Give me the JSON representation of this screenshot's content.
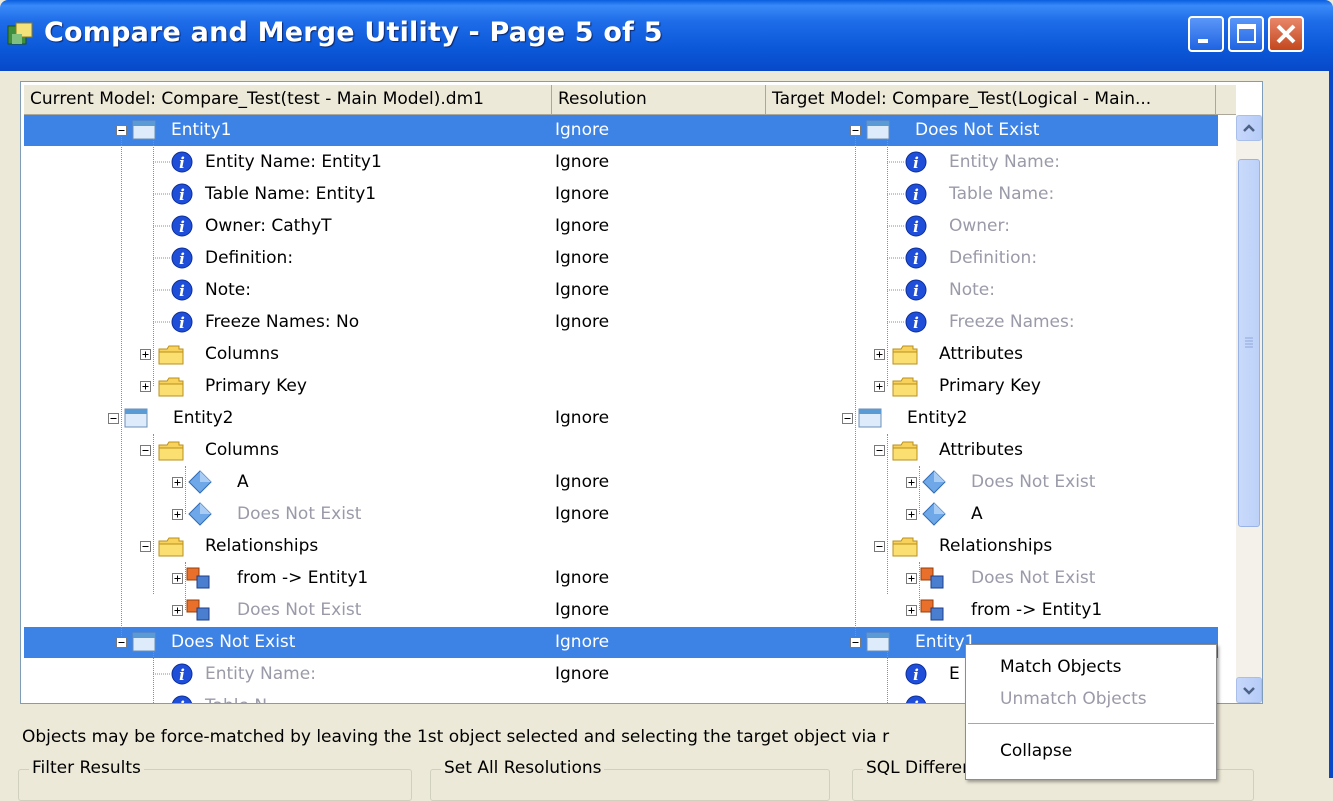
{
  "window": {
    "title": "Compare and Merge Utility  - Page 5 of 5"
  },
  "tree": {
    "columns": [
      "Current Model: Compare_Test(test - Main Model).dm1",
      "Resolution",
      "Target Model: Compare_Test(Logical - Main..."
    ],
    "left": {
      "entity1": "Entity1",
      "entity_name": "Entity Name: Entity1",
      "table_name": "Table Name: Entity1",
      "owner": "Owner: CathyT",
      "definition": "Definition:",
      "note": "Note:",
      "freeze_names": "Freeze Names: No",
      "columns": "Columns",
      "primary_key": "Primary Key",
      "entity2": "Entity2",
      "columns2": "Columns",
      "col_a": "A",
      "col_dne": "Does Not Exist",
      "relationships": "Relationships",
      "rel_from": "from -> Entity1",
      "rel_dne": "Does Not Exist",
      "dne_entity": "Does Not Exist",
      "dne_entity_name": "Entity Name:",
      "dne_table_name": "Table N..."
    },
    "resolution": {
      "r1": "Ignore",
      "r2": "Ignore",
      "r3": "Ignore",
      "r4": "Ignore",
      "r5": "Ignore",
      "r6": "Ignore",
      "r7": "Ignore",
      "r10": "Ignore",
      "r12": "Ignore",
      "r13": "Ignore",
      "r15": "Ignore",
      "r16": "Ignore",
      "r17": "Ignore",
      "r18": "Ignore"
    },
    "right": {
      "dne_entity": "Does Not Exist",
      "entity_name": "Entity Name:",
      "table_name": "Table Name:",
      "owner": "Owner:",
      "definition": "Definition:",
      "note": "Note:",
      "freeze_names": "Freeze Names:",
      "attributes": "Attributes",
      "primary_key": "Primary Key",
      "entity2": "Entity2",
      "attributes2": "Attributes",
      "attr_dne": "Does Not Exist",
      "attr_a": "A",
      "relationships": "Relationships",
      "rel_dne": "Does Not Exist",
      "rel_from": "from -> Entity1",
      "entity1": "Entity1",
      "e_trunc": "E"
    }
  },
  "context_menu": {
    "match": "Match Objects",
    "unmatch": "Unmatch Objects",
    "collapse": "Collapse"
  },
  "hint": "Objects may be force-matched by leaving the 1st object selected and selecting the target object via r",
  "groups": {
    "filter": "Filter Results",
    "set_all": "Set All Resolutions",
    "sql": "SQL Difference"
  },
  "colors": {
    "selection": "#3D82E5",
    "titlebar": "#0A58D8",
    "disabled_text": "#9A9AA8"
  }
}
